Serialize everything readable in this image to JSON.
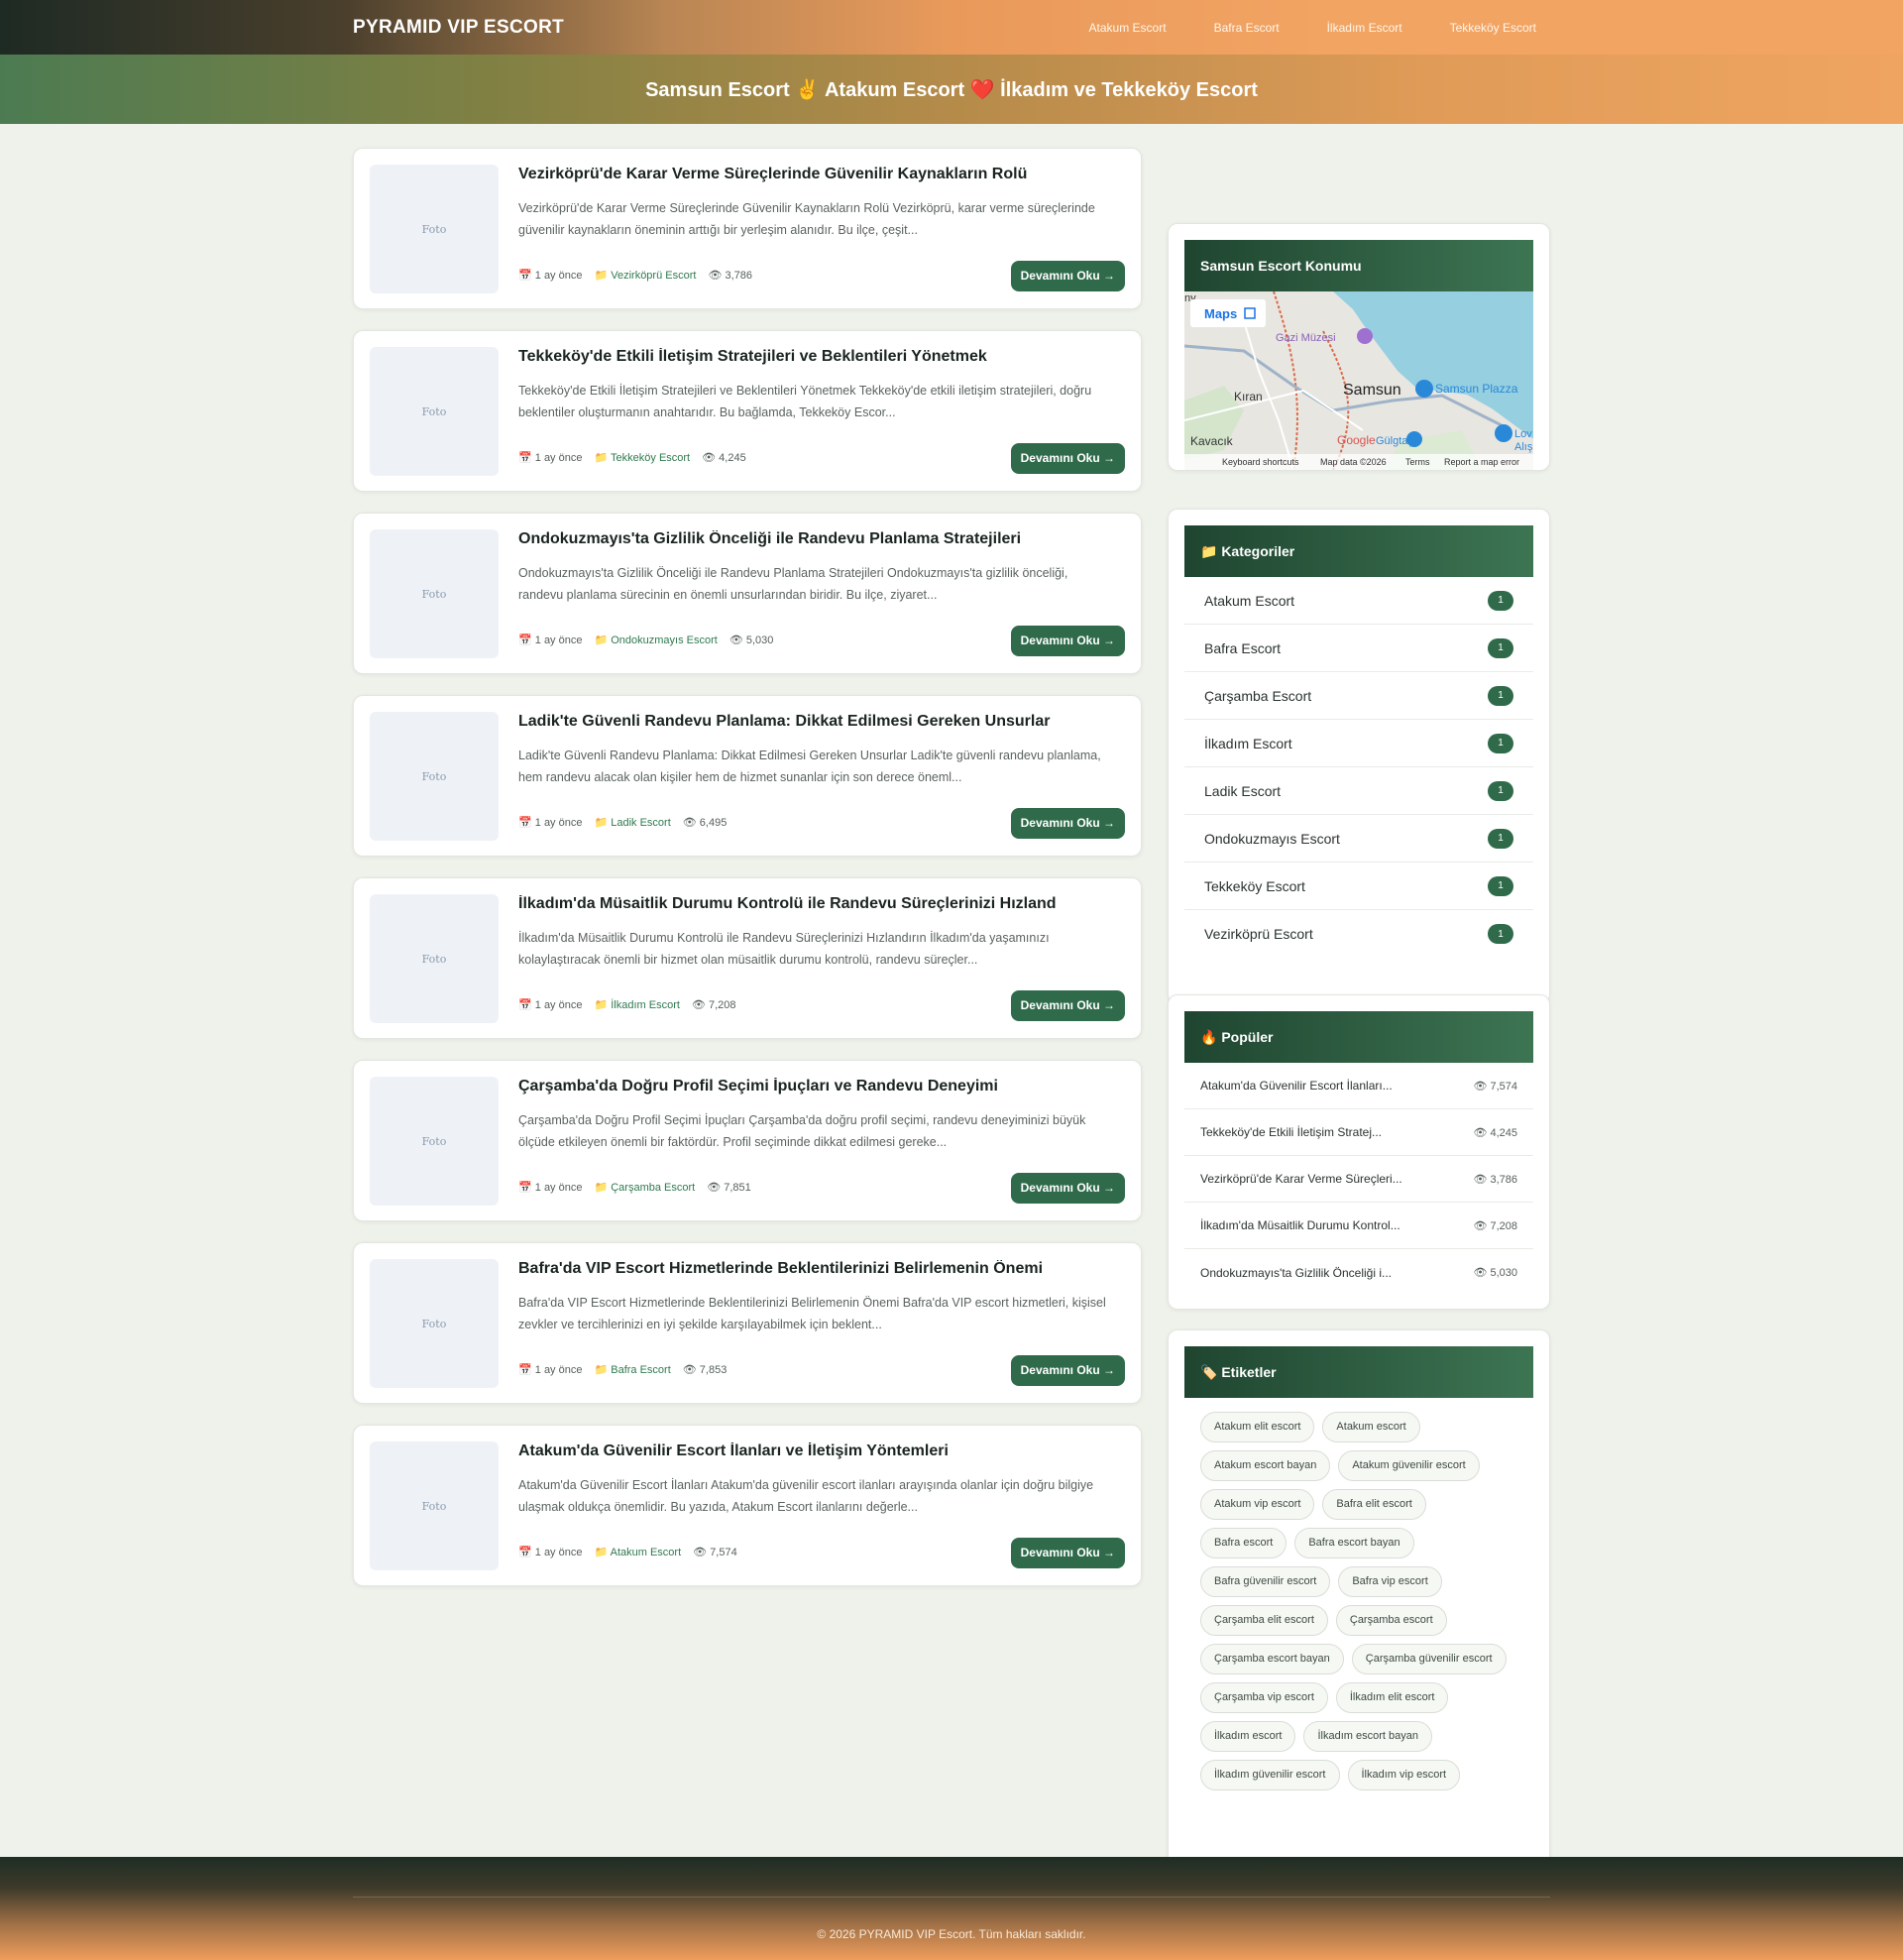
{
  "site": {
    "brand": "PYRAMID VIP ESCORT",
    "nav": [
      "Atakum Escort",
      "Bafra Escort",
      "İlkadım Escort",
      "Tekkeköy Escort"
    ],
    "hero_title": "Samsun Escort ✌️ Atakum Escort ❤️ İlkadım ve Tekkeköy Escort"
  },
  "posts": [
    {
      "title": "Vezirköprü'de Karar Verme Süreçlerinde Güvenilir Kaynakların Rolü",
      "excerpt": "Vezirköprü'de Karar Verme Süreçlerinde Güvenilir Kaynakların Rolü Vezirköprü, karar verme süreçlerinde güvenilir kaynakların öneminin arttığı bir yerleşim alanıdır. Bu ilçe, çeşit...",
      "date": "1 ay önce",
      "category": "Vezirköprü Escort",
      "views": "3,786",
      "thumb": "Foto",
      "button": "Devamını Oku →"
    },
    {
      "title": "Tekkeköy'de Etkili İletişim Stratejileri ve Beklentileri Yönetmek",
      "excerpt": "Tekkeköy'de Etkili İletişim Stratejileri ve Beklentileri Yönetmek Tekkeköy'de etkili iletişim stratejileri, doğru beklentiler oluşturmanın anahtarıdır. Bu bağlamda, Tekkeköy Escor...",
      "date": "1 ay önce",
      "category": "Tekkeköy Escort",
      "views": "4,245",
      "thumb": "Foto",
      "button": "Devamını Oku →"
    },
    {
      "title": "Ondokuzmayıs'ta Gizlilik Önceliği ile Randevu Planlama Stratejileri",
      "excerpt": "Ondokuzmayıs'ta Gizlilik Önceliği ile Randevu Planlama Stratejileri Ondokuzmayıs'ta gizlilik önceliği, randevu planlama sürecinin en önemli unsurlarından biridir. Bu ilçe, ziyaret...",
      "date": "1 ay önce",
      "category": "Ondokuzmayıs Escort",
      "views": "5,030",
      "thumb": "Foto",
      "button": "Devamını Oku →"
    },
    {
      "title": "Ladik'te Güvenli Randevu Planlama: Dikkat Edilmesi Gereken Unsurlar",
      "excerpt": "Ladik'te Güvenli Randevu Planlama: Dikkat Edilmesi Gereken Unsurlar Ladik'te güvenli randevu planlama, hem randevu alacak olan kişiler hem de hizmet sunanlar için son derece öneml...",
      "date": "1 ay önce",
      "category": "Ladik Escort",
      "views": "6,495",
      "thumb": "Foto",
      "button": "Devamını Oku →"
    },
    {
      "title": "İlkadım'da Müsaitlik Durumu Kontrolü ile Randevu Süreçlerinizi Hızland",
      "excerpt": "İlkadım'da Müsaitlik Durumu Kontrolü ile Randevu Süreçlerinizi Hızlandırın İlkadım'da yaşamınızı kolaylaştıracak önemli bir hizmet olan müsaitlik durumu kontrolü, randevu süreçler...",
      "date": "1 ay önce",
      "category": "İlkadım Escort",
      "views": "7,208",
      "thumb": "Foto",
      "button": "Devamını Oku →"
    },
    {
      "title": "Çarşamba'da Doğru Profil Seçimi İpuçları ve Randevu Deneyimi",
      "excerpt": "Çarşamba'da Doğru Profil Seçimi İpuçları Çarşamba'da doğru profil seçimi, randevu deneyiminizi büyük ölçüde etkileyen önemli bir faktördür. Profil seçiminde dikkat edilmesi gereke...",
      "date": "1 ay önce",
      "category": "Çarşamba Escort",
      "views": "7,851",
      "thumb": "Foto",
      "button": "Devamını Oku →"
    },
    {
      "title": "Bafra'da VIP Escort Hizmetlerinde Beklentilerinizi Belirlemenin Önemi",
      "excerpt": "Bafra'da VIP Escort Hizmetlerinde Beklentilerinizi Belirlemenin Önemi Bafra'da VIP escort hizmetleri, kişisel zevkler ve tercihlerinizi en iyi şekilde karşılayabilmek için beklent...",
      "date": "1 ay önce",
      "category": "Bafra Escort",
      "views": "7,853",
      "thumb": "Foto",
      "button": "Devamını Oku →"
    },
    {
      "title": "Atakum'da Güvenilir Escort İlanları ve İletişim Yöntemleri",
      "excerpt": "Atakum'da Güvenilir Escort İlanları Atakum'da güvenilir escort ilanları arayışında olanlar için doğru bilgiye ulaşmak oldukça önemlidir. Bu yazıda, Atakum Escort ilanlarını değerle...",
      "date": "1 ay önce",
      "category": "Atakum Escort",
      "views": "7,574",
      "thumb": "Foto",
      "button": "Devamını Oku →"
    }
  ],
  "map_widget": {
    "title": "Samsun Escort Konumu",
    "maps_button": "Maps",
    "labels": {
      "gazi": "Gazi Müzesi",
      "kiran": "Kıran",
      "samsun": "Samsun",
      "kavacik": "Kavacık",
      "plaza": "Samsun Plazza",
      "gulgtas": "Gülgtaş",
      "lov": "Lov",
      "alis": "Alış",
      "edge": "ny"
    },
    "footer": [
      "Keyboard shortcuts",
      "Map data ©2026",
      "Terms",
      "Report a map error"
    ],
    "google": "Google"
  },
  "categories_widget": {
    "title": "📁 Kategoriler",
    "items": [
      {
        "name": "Atakum Escort",
        "count": "1"
      },
      {
        "name": "Bafra Escort",
        "count": "1"
      },
      {
        "name": "Çarşamba Escort",
        "count": "1"
      },
      {
        "name": "İlkadım Escort",
        "count": "1"
      },
      {
        "name": "Ladik Escort",
        "count": "1"
      },
      {
        "name": "Ondokuzmayıs Escort",
        "count": "1"
      },
      {
        "name": "Tekkeköy Escort",
        "count": "1"
      },
      {
        "name": "Vezirköprü Escort",
        "count": "1"
      }
    ]
  },
  "popular_widget": {
    "title": "🔥 Popüler",
    "items": [
      {
        "title": "Atakum'da Güvenilir Escort İlanları...",
        "views": "7,574"
      },
      {
        "title": "Tekkeköy'de Etkili İletişim Strate​j...",
        "views": "4,245"
      },
      {
        "title": "Vezirköprü'de Karar Verme Süreçleri...",
        "views": "3,786"
      },
      {
        "title": "İlkadım'da Müsaitlik Durumu Kontrol...",
        "views": "7,208"
      },
      {
        "title": "Ondokuzmayıs'ta Gizlilik Önceliği i...",
        "views": "5,030"
      }
    ]
  },
  "tags_widget": {
    "title": "🏷️ Etiketler",
    "tags": [
      "Atakum elit escort",
      "Atakum escort",
      "Atakum escort bayan",
      "Atakum güvenilir escort",
      "Atakum vip escort",
      "Bafra elit escort",
      "Bafra escort",
      "Bafra escort bayan",
      "Bafra güvenilir escort",
      "Bafra vip escort",
      "Çarşamba elit escort",
      "Çarşamba escort",
      "Çarşamba escort bayan",
      "Çarşamba güvenilir escort",
      "Çarşamba vip escort",
      "İlkadım elit escort",
      "İlkadım escort",
      "İlkadım escort bayan",
      "İlkadım güvenilir escort",
      "İlkadım vip escort"
    ]
  },
  "footer": {
    "copyright": "© 2026 PYRAMID VIP Escort. Tüm hakları saklıdır."
  },
  "icons": {
    "date": "calendar-icon",
    "category": "folder-icon",
    "views": "eye-icon"
  },
  "colors": {
    "accent": "#2f6b4a",
    "header_orange": "#f2a463",
    "header_dark": "#1e2a24"
  }
}
